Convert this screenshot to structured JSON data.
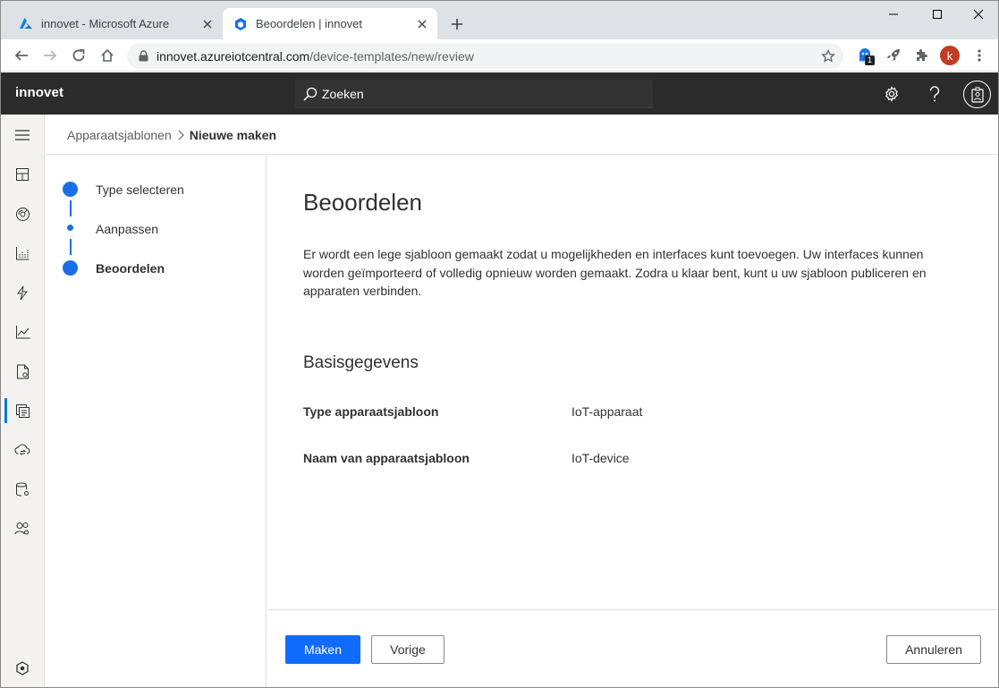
{
  "browser": {
    "tabs": [
      {
        "title": "innovet - Microsoft Azure",
        "active": false,
        "icon": "azure-logo-icon"
      },
      {
        "title": "Beoordelen | innovet",
        "active": true,
        "icon": "iot-central-icon"
      }
    ],
    "url": {
      "host": "innovet.azureiotcentral.com",
      "path": "/device-templates/new/review"
    },
    "extension_badge": "1",
    "profile_initial": "k"
  },
  "app": {
    "brand": "innovet",
    "search_placeholder": "Zoeken"
  },
  "nav": {
    "items": [
      "menu-icon",
      "dashboard-icon",
      "devices-icon",
      "device-groups-icon",
      "rules-icon",
      "analytics-icon",
      "jobs-icon",
      "device-templates-icon",
      "data-export-icon",
      "administration-icon",
      "users-icon"
    ],
    "selected": "device-templates-icon",
    "footer": "iot-central-logo-icon"
  },
  "breadcrumb": {
    "parent": "Apparaatsjablonen",
    "current": "Nieuwe maken"
  },
  "steps": [
    {
      "label": "Type selecteren",
      "state": "complete"
    },
    {
      "label": "Aanpassen",
      "state": "skipped"
    },
    {
      "label": "Beoordelen",
      "state": "current"
    }
  ],
  "review": {
    "title": "Beoordelen",
    "description": "Er wordt een lege sjabloon gemaakt zodat u mogelijkheden en interfaces kunt toevoegen. Uw interfaces kunnen worden geïmporteerd of volledig opnieuw worden gemaakt. Zodra u klaar bent, kunt u uw sjabloon publiceren en apparaten verbinden.",
    "section_title": "Basisgegevens",
    "properties": [
      {
        "name": "Type apparaatsjabloon",
        "value": "IoT-apparaat"
      },
      {
        "name": "Naam van apparaatsjabloon",
        "value": "IoT-device"
      }
    ]
  },
  "footer": {
    "create": "Maken",
    "previous": "Vorige",
    "cancel": "Annuleren"
  },
  "colors": {
    "accent": "#0f6cff",
    "header_bg": "#2b2b2b",
    "nav_bg": "#f3f2f1",
    "step": "#1a6fe8"
  }
}
